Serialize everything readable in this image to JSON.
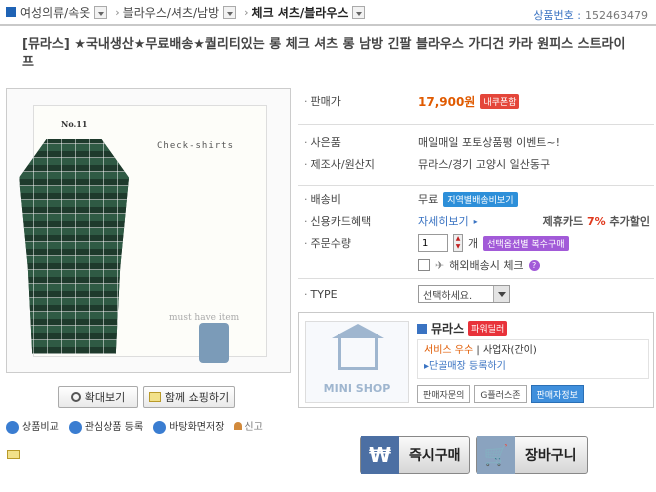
{
  "breadcrumb": {
    "cat1": "여성의류/속옷",
    "cat2": "블라우스/셔츠/남방",
    "current": "체크 셔츠/블라우스",
    "sep": "›",
    "product_no_label": "상품번호 :",
    "product_no": "152463479"
  },
  "product": {
    "title": "[뮤라스] ★국내생산★무료배송★퀄리티있는 롱 체크 셔츠 롱 남방 긴팔 블라우스 가디건 카라 원피스 스트라이프",
    "image_no": "No.11",
    "image_caption": "Check-shirts",
    "image_caption2": "must have item"
  },
  "image_buttons": {
    "zoom": "확대보기",
    "shop_together": "함께 쇼핑하기"
  },
  "links": {
    "compare": "상품비교",
    "favorite": "관심상품 등록",
    "desktop": "바탕화면저장",
    "report": "신고"
  },
  "info": {
    "price_label": "판매가",
    "price": "17,900원",
    "coupon": "내쿠폰함",
    "gift_label": "사은품",
    "gift": "매일매일 포토상품평 이벤트~!",
    "maker_label": "제조사/원산지",
    "maker": "뮤라스/경기 고양시 일산동구",
    "ship_label": "배송비",
    "ship": "무료",
    "ship_region": "지역별배송비보기",
    "card_label": "신용카드혜택",
    "card_more": "자세히보기",
    "card_disc_pre": "제휴카드",
    "card_disc_rate": "7%",
    "card_disc_post": "추가할인",
    "qty_label": "주문수량",
    "qty_value": "1",
    "qty_unit": "개",
    "qty_option": "선택옵션별 복수구매",
    "overseas": "해외배송시 체크",
    "type_label": "TYPE",
    "type_select": "선택하세요."
  },
  "shop": {
    "mini": "MINI SHOP",
    "name": "뮤라스",
    "power": "파워딜러",
    "service": "서비스",
    "service_grade": "우수",
    "biz": "| 사업자(간이)",
    "outlet": "단골매장 등록하기",
    "btn_inquiry": "판매자문의",
    "btn_gplus": "G플러스존",
    "btn_seller": "판매자정보"
  },
  "actions": {
    "buy": "즉시구매",
    "cart": "장바구니"
  }
}
